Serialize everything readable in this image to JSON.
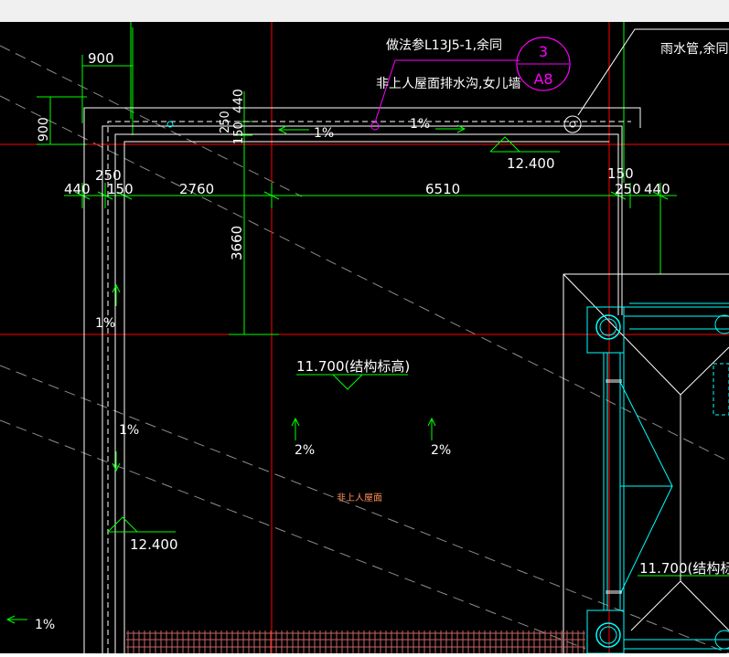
{
  "annotations": {
    "practice_note": "做法参L13J5-1,余同",
    "gutter_note": "非上人屋面排水沟,女儿墙",
    "downpipe_note": "雨水管,余同",
    "roof_type": "非上人屋面"
  },
  "index_mark": {
    "number": "3",
    "sheet": "A8"
  },
  "dimensions": {
    "d900_top": "900",
    "d900_left": "900",
    "d440_vert": "440",
    "d250_vert": "250",
    "d150_vert": "150",
    "d250_left": "250",
    "d440_left": "440",
    "d150_left": "150",
    "d2760": "2760",
    "d6510": "6510",
    "d150_right": "150",
    "d250_right": "250",
    "d440_right": "440",
    "d3660": "3660"
  },
  "elevations": {
    "top_right": "12.400",
    "bottom_left": "12.400",
    "structural_center": "11.700(结构标高)",
    "structural_right": "11.700(结构标"
  },
  "slopes": {
    "gutter_left": "1%",
    "gutter_right": "1%",
    "side_upper": "1%",
    "side_lower": "1%",
    "roof_left": "2%",
    "roof_right": "2%",
    "bottom_gutter": "1%"
  },
  "colors": {
    "background": "#000000",
    "wall": "#ffffff",
    "dimension": "#00ff00",
    "axis": "#ff0000",
    "annotation": "#ff00ff",
    "structure": "#00ffff",
    "roof_label": "#ff8c5a",
    "hatch": "#c86464"
  }
}
